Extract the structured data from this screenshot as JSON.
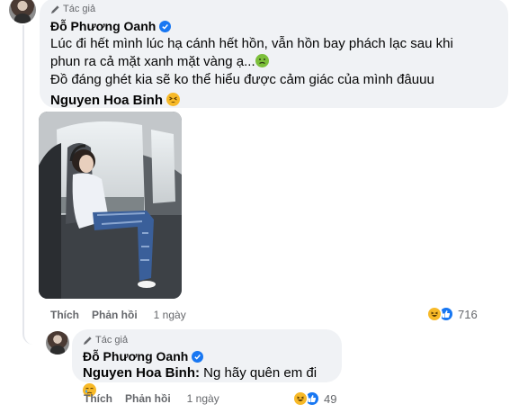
{
  "comment1": {
    "author_tag": "Tác giả",
    "author_name": "Đỗ Phương Oanh",
    "text_line1": "Lúc đi hết mình lúc hạ cánh hết hồn, vẫn hồn bay phách lạc sau khi",
    "text_line2": "phun ra cả mặt xanh mặt vàng ạ...",
    "text_line3": "Đồ đáng ghét kia sẽ ko thể hiểu được cảm giác của mình đâuuu",
    "mention": "Nguyen Hoa Binh",
    "like_label": "Thích",
    "reply_label": "Phản hồi",
    "time": "1 ngày",
    "reaction_count": "716"
  },
  "comment2": {
    "author_tag": "Tác giả",
    "author_name": "Đỗ Phương Oanh",
    "mention": "Nguyen Hoa Binh:",
    "text": "Ng hãy quên em đi",
    "like_label": "Thích",
    "reply_label": "Phản hồi",
    "time": "1 ngày",
    "reaction_count": "49"
  },
  "colors": {
    "bubble": "#f0f2f5",
    "verified": "#1877f2",
    "haha": "#f7b928",
    "like": "#1877f2",
    "secondary_text": "#65676b"
  },
  "icons": [
    "pencil-icon",
    "verified-badge-icon",
    "nauseated-emoji",
    "tired-emoji",
    "crying-emoji",
    "haha-reaction-icon",
    "like-reaction-icon"
  ]
}
